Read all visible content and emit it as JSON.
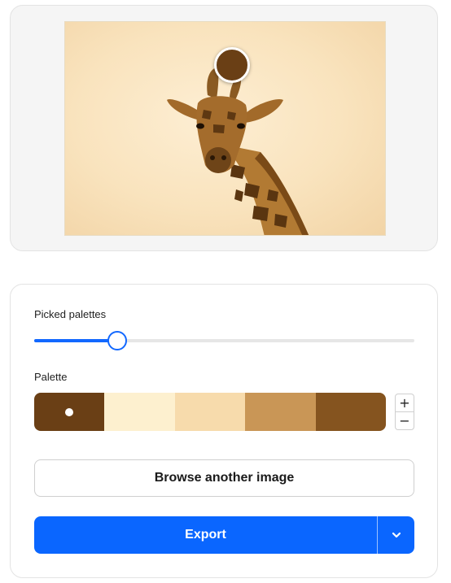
{
  "image": {
    "alt": "Giraffe",
    "picked_color": "#6a3f15"
  },
  "controls": {
    "picked_label": "Picked palettes",
    "slider_value": 0.218,
    "palette_label": "Palette",
    "palette": [
      {
        "color": "#6a3f15",
        "selected": true
      },
      {
        "color": "#fdf0cf",
        "selected": false
      },
      {
        "color": "#f7dbac",
        "selected": false
      },
      {
        "color": "#c99656",
        "selected": false
      },
      {
        "color": "#85541f",
        "selected": false
      }
    ],
    "stepper": {
      "plus": "+",
      "minus": "−"
    },
    "browse_label": "Browse another image",
    "export_label": "Export",
    "export_dropdown_icon": "chevron-down-icon"
  },
  "colors": {
    "accent": "#0a66ff",
    "slider_accent": "#1268ff"
  }
}
